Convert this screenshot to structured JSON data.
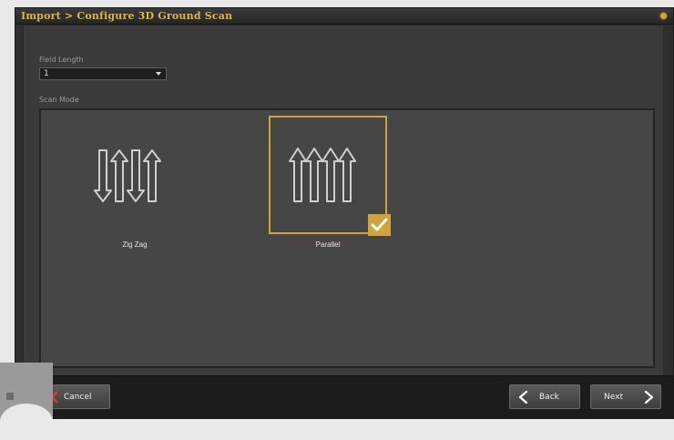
{
  "window": {
    "title": "Import > Configure 3D Ground Scan"
  },
  "field_length": {
    "label": "Field Length",
    "value": "1"
  },
  "scan_mode": {
    "label": "Scan Mode",
    "options": [
      {
        "label": "Zig Zag",
        "selected": false
      },
      {
        "label": "Parallel",
        "selected": true
      }
    ]
  },
  "footer": {
    "cancel_label": "Cancel",
    "back_label": "Back",
    "next_label": "Next"
  },
  "colors": {
    "accent": "#cfa43a",
    "title_text": "#e0b640",
    "background": "#3a3a3a"
  }
}
